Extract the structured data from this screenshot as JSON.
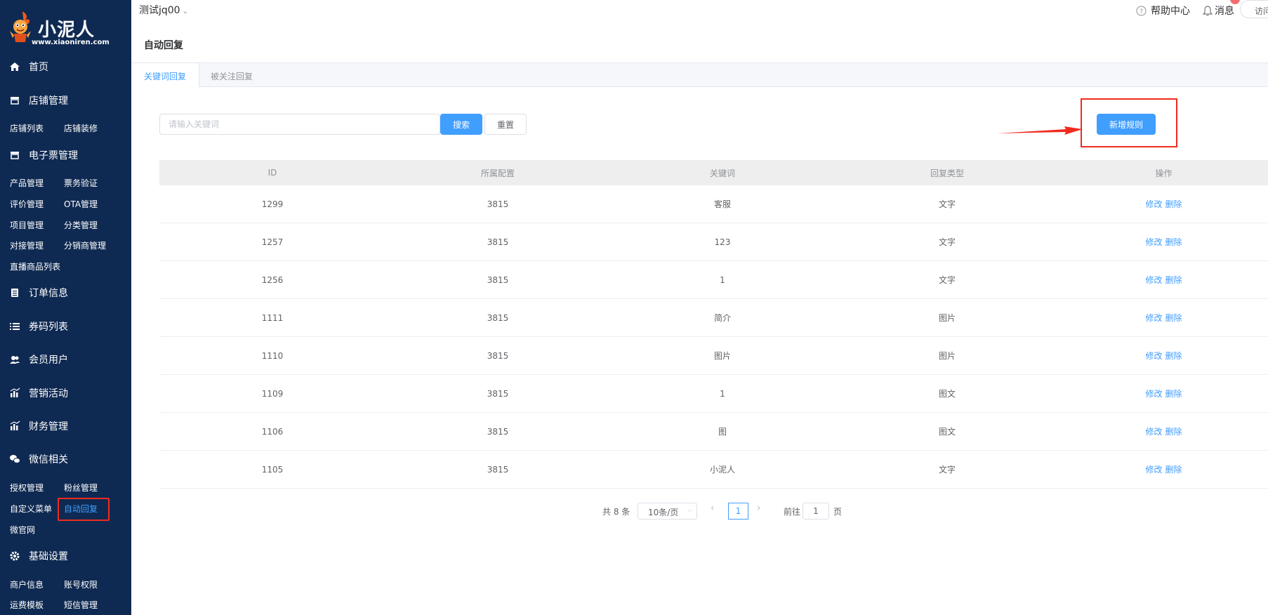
{
  "brand": {
    "name": "小泥人",
    "url": "www.xiaoniren.com"
  },
  "header": {
    "store": "测试jq00",
    "help": "帮助中心",
    "messages": "消息",
    "visit": "访问"
  },
  "sidebar": {
    "home": "首页",
    "shop": {
      "label": "店铺管理",
      "items": [
        "店铺列表",
        "店铺装修"
      ]
    },
    "eticket": {
      "label": "电子票管理",
      "items": [
        "产品管理",
        "票务验证",
        "评价管理",
        "OTA管理",
        "项目管理",
        "分类管理",
        "对接管理",
        "分销商管理",
        "直播商品列表"
      ]
    },
    "orders": "订单信息",
    "coupons": "券码列表",
    "members": "会员用户",
    "marketing": "营销活动",
    "finance": "财务管理",
    "wechat": {
      "label": "微信相关",
      "items": [
        "授权管理",
        "粉丝管理",
        "自定义菜单",
        "自动回复",
        "微官网"
      ]
    },
    "settings": {
      "label": "基础设置",
      "items": [
        "商户信息",
        "账号权限",
        "运费模板",
        "短信管理"
      ]
    }
  },
  "page": {
    "title": "自动回复"
  },
  "tabs": [
    "关键词回复",
    "被关注回复"
  ],
  "search": {
    "placeholder": "请输入关键词",
    "search_label": "搜索",
    "reset_label": "重置",
    "add_label": "新增规则"
  },
  "table": {
    "headers": [
      "ID",
      "所属配置",
      "关键词",
      "回复类型",
      "操作"
    ],
    "edit_label": "修改",
    "delete_label": "删除",
    "rows": [
      [
        "1299",
        "3815",
        "客服",
        "文字"
      ],
      [
        "1257",
        "3815",
        "123",
        "文字"
      ],
      [
        "1256",
        "3815",
        "1",
        "文字"
      ],
      [
        "1111",
        "3815",
        "简介",
        "图片"
      ],
      [
        "1110",
        "3815",
        "图片",
        "图片"
      ],
      [
        "1109",
        "3815",
        "1",
        "图文"
      ],
      [
        "1106",
        "3815",
        "图",
        "图文"
      ],
      [
        "1105",
        "3815",
        "小泥人",
        "文字"
      ]
    ]
  },
  "pagination": {
    "total": "共 8 条",
    "page_size": "10条/页",
    "current": "1",
    "goto_prefix": "前往",
    "goto_value": "1",
    "goto_suffix": "页"
  },
  "colors": {
    "sidebar_bg": "#0f2a52",
    "primary": "#409eff",
    "annotation_red": "#f02b1e"
  }
}
